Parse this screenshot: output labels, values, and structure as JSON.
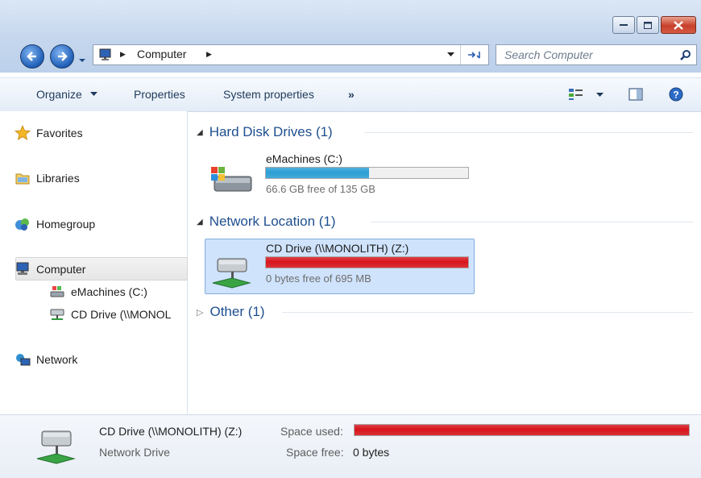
{
  "window": {
    "accent": "#1e4f8f"
  },
  "address": {
    "location_label": "Computer",
    "search_placeholder": "Search Computer"
  },
  "commandbar": {
    "organize": "Organize",
    "properties": "Properties",
    "system_properties": "System properties",
    "more": "»"
  },
  "navpane": {
    "favorites": "Favorites",
    "libraries": "Libraries",
    "homegroup": "Homegroup",
    "computer": "Computer",
    "computer_children": [
      "eMachines (C:)",
      "CD Drive (\\\\MONOL"
    ],
    "network": "Network"
  },
  "groups": {
    "hdd": {
      "title": "Hard Disk Drives (1)"
    },
    "network": {
      "title": "Network Location (1)"
    },
    "other": {
      "title": "Other (1)"
    }
  },
  "drives": {
    "c": {
      "name": "eMachines (C:)",
      "info": "66.6 GB free of 135 GB",
      "used_fraction": 0.51,
      "bar_color": "#2a9fd6"
    },
    "z": {
      "name": "CD Drive (\\\\MONOLITH) (Z:)",
      "info": "0 bytes free of 695 MB",
      "used_fraction": 1.0,
      "bar_color": "#d8141c"
    }
  },
  "details": {
    "name": "CD Drive (\\\\MONOLITH) (Z:)",
    "type": "Network Drive",
    "space_used_label": "Space used:",
    "space_free_label": "Space free:",
    "space_free_value": "0 bytes",
    "used_fraction": 1.0
  }
}
